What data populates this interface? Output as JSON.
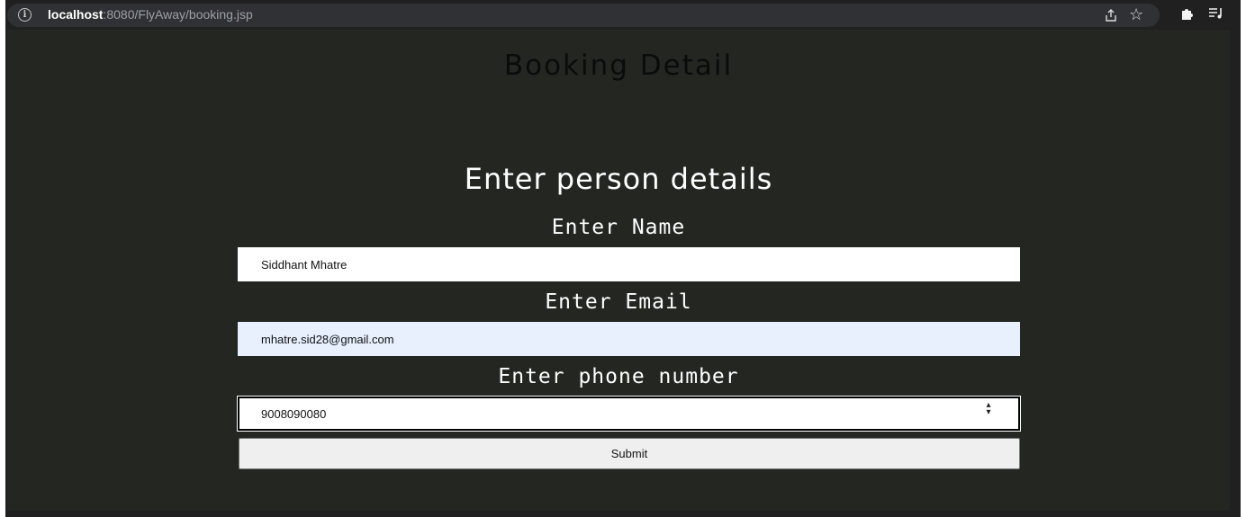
{
  "browser": {
    "url_host": "localhost",
    "url_rest": ":8080/FlyAway/booking.jsp",
    "icons": [
      "info-icon",
      "share-icon",
      "star-icon",
      "extensions-icon",
      "reading-list-icon"
    ]
  },
  "page": {
    "title": "Booking Detail",
    "section_title": "Enter person details"
  },
  "form": {
    "name_label": "Enter Name",
    "name_value": "Siddhant Mhatre",
    "email_label": "Enter Email",
    "email_value": "mhatre.sid28@gmail.com",
    "phone_label": "Enter phone number",
    "phone_value": "9008090080",
    "submit_label": "Submit"
  }
}
